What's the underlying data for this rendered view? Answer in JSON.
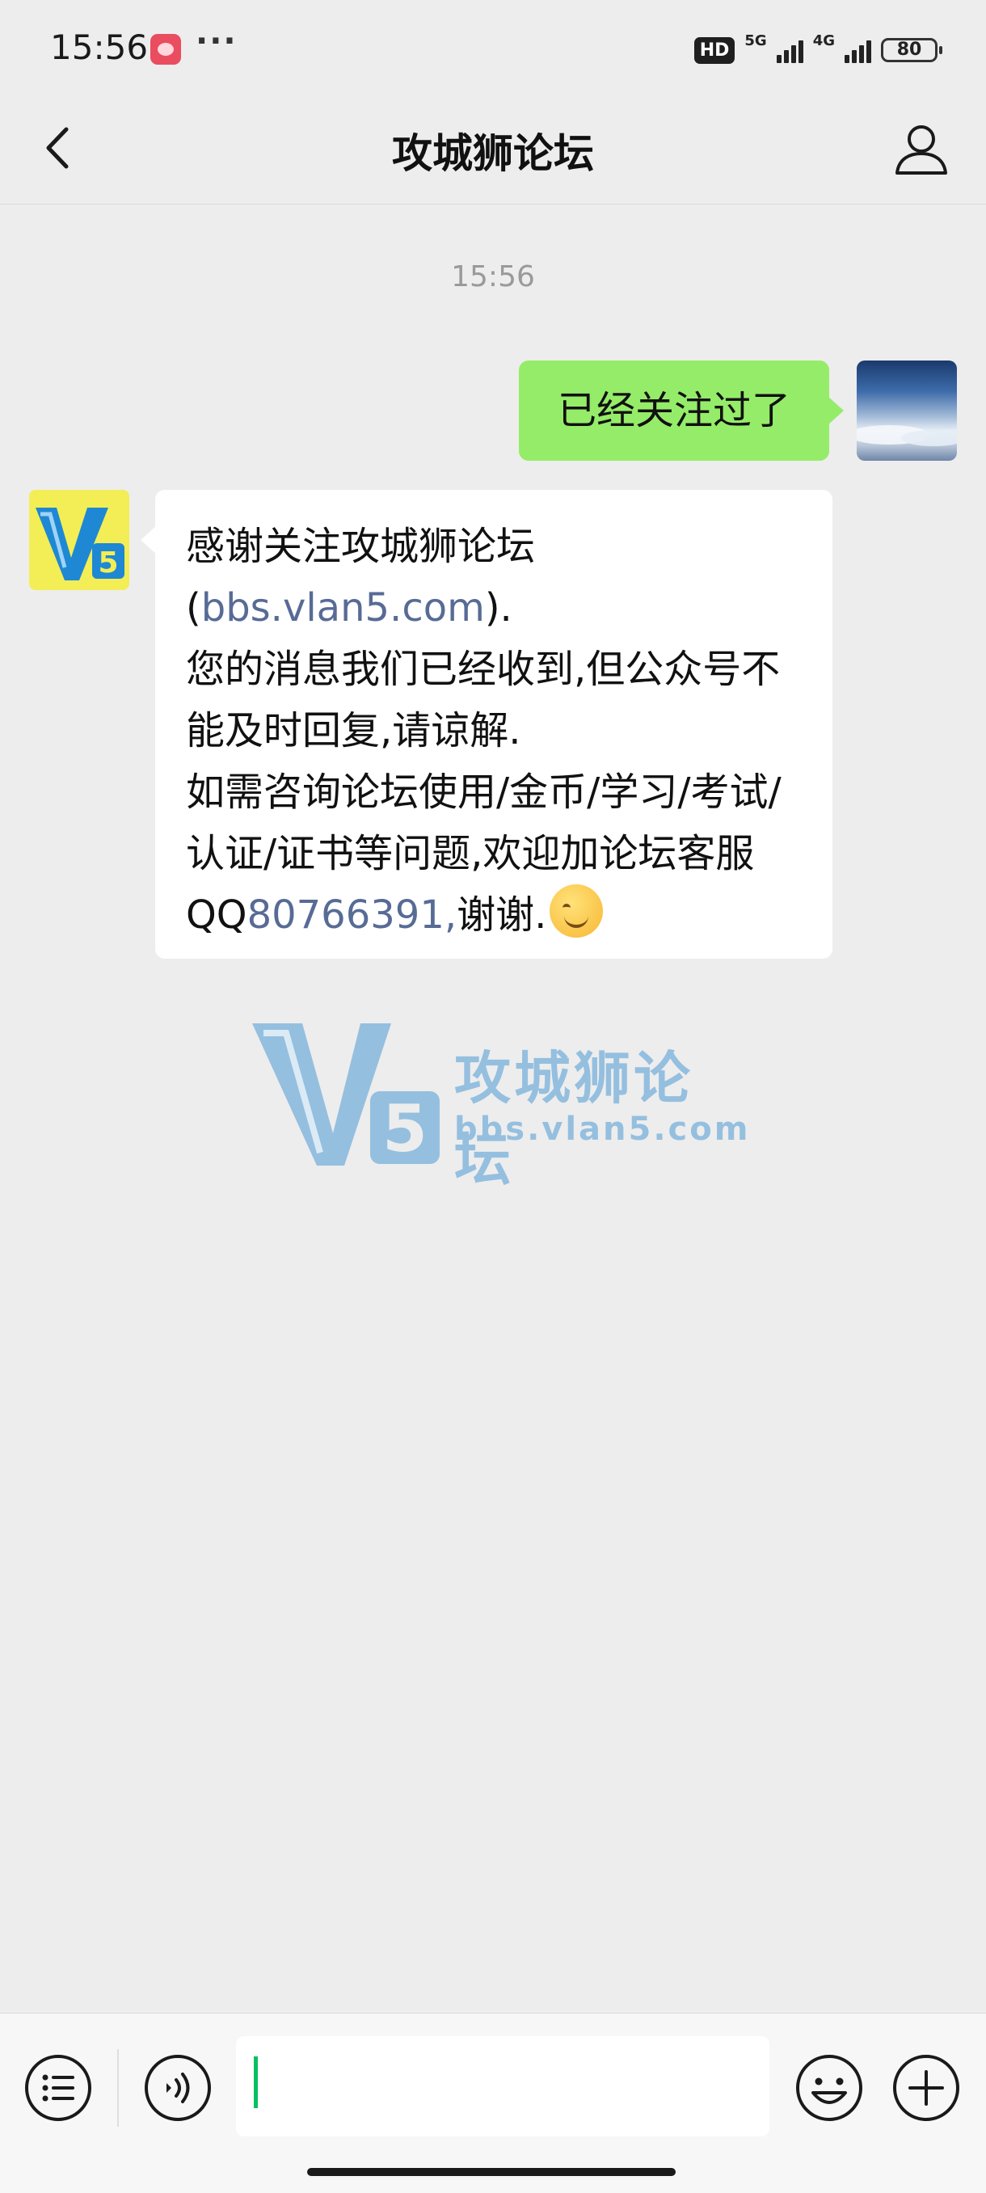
{
  "status_bar": {
    "time": "15:56",
    "more": "···",
    "hd_badge": "HD",
    "network_1": "5G",
    "network_2": "4G",
    "battery": "80"
  },
  "nav": {
    "title": "攻城狮论坛",
    "back_icon": "chevron-left-icon",
    "profile_icon": "person-icon"
  },
  "chat": {
    "timestamp": "15:56",
    "messages": [
      {
        "sender": "me",
        "text": "已经关注过了"
      },
      {
        "sender": "bot",
        "line1_prefix": "感谢关注攻城狮论坛(",
        "link_url": "bbs.vlan5.com",
        "line1_suffix": ").",
        "line2": "您的消息我们已经收到,但公众号不能及时回复,请谅解.",
        "line3_prefix": "如需咨询论坛使用/金币/学习/考试/认证/证书等问题,欢迎加论坛客服 QQ",
        "qq_link": "80766391,",
        "line3_suffix": "谢谢."
      }
    ]
  },
  "watermark": {
    "title": "攻城狮论坛",
    "url": "bbs.vlan5.com"
  },
  "input_bar": {
    "value": "",
    "placeholder": ""
  },
  "colors": {
    "background": "#ededed",
    "my_bubble": "#95ec69",
    "link": "#576b95",
    "accent_caret": "#07c160"
  }
}
